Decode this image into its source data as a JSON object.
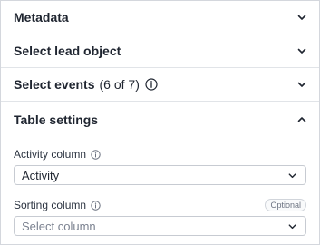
{
  "sections": {
    "metadata": {
      "title": "Metadata"
    },
    "lead_object": {
      "title": "Select lead object"
    },
    "events": {
      "title": "Select events",
      "count": "(6 of 7)"
    },
    "table_settings": {
      "title": "Table settings"
    }
  },
  "table_settings": {
    "activity_column": {
      "label": "Activity column",
      "value": "Activity"
    },
    "sorting_column": {
      "label": "Sorting column",
      "badge": "Optional",
      "placeholder": "Select column"
    }
  },
  "colors": {
    "border": "#d4d7dd",
    "text": "#1f2530",
    "muted": "#7b8290"
  },
  "icons": {
    "collapsed": "chevron-down-icon",
    "expanded": "chevron-up-icon",
    "info": "info-icon"
  }
}
